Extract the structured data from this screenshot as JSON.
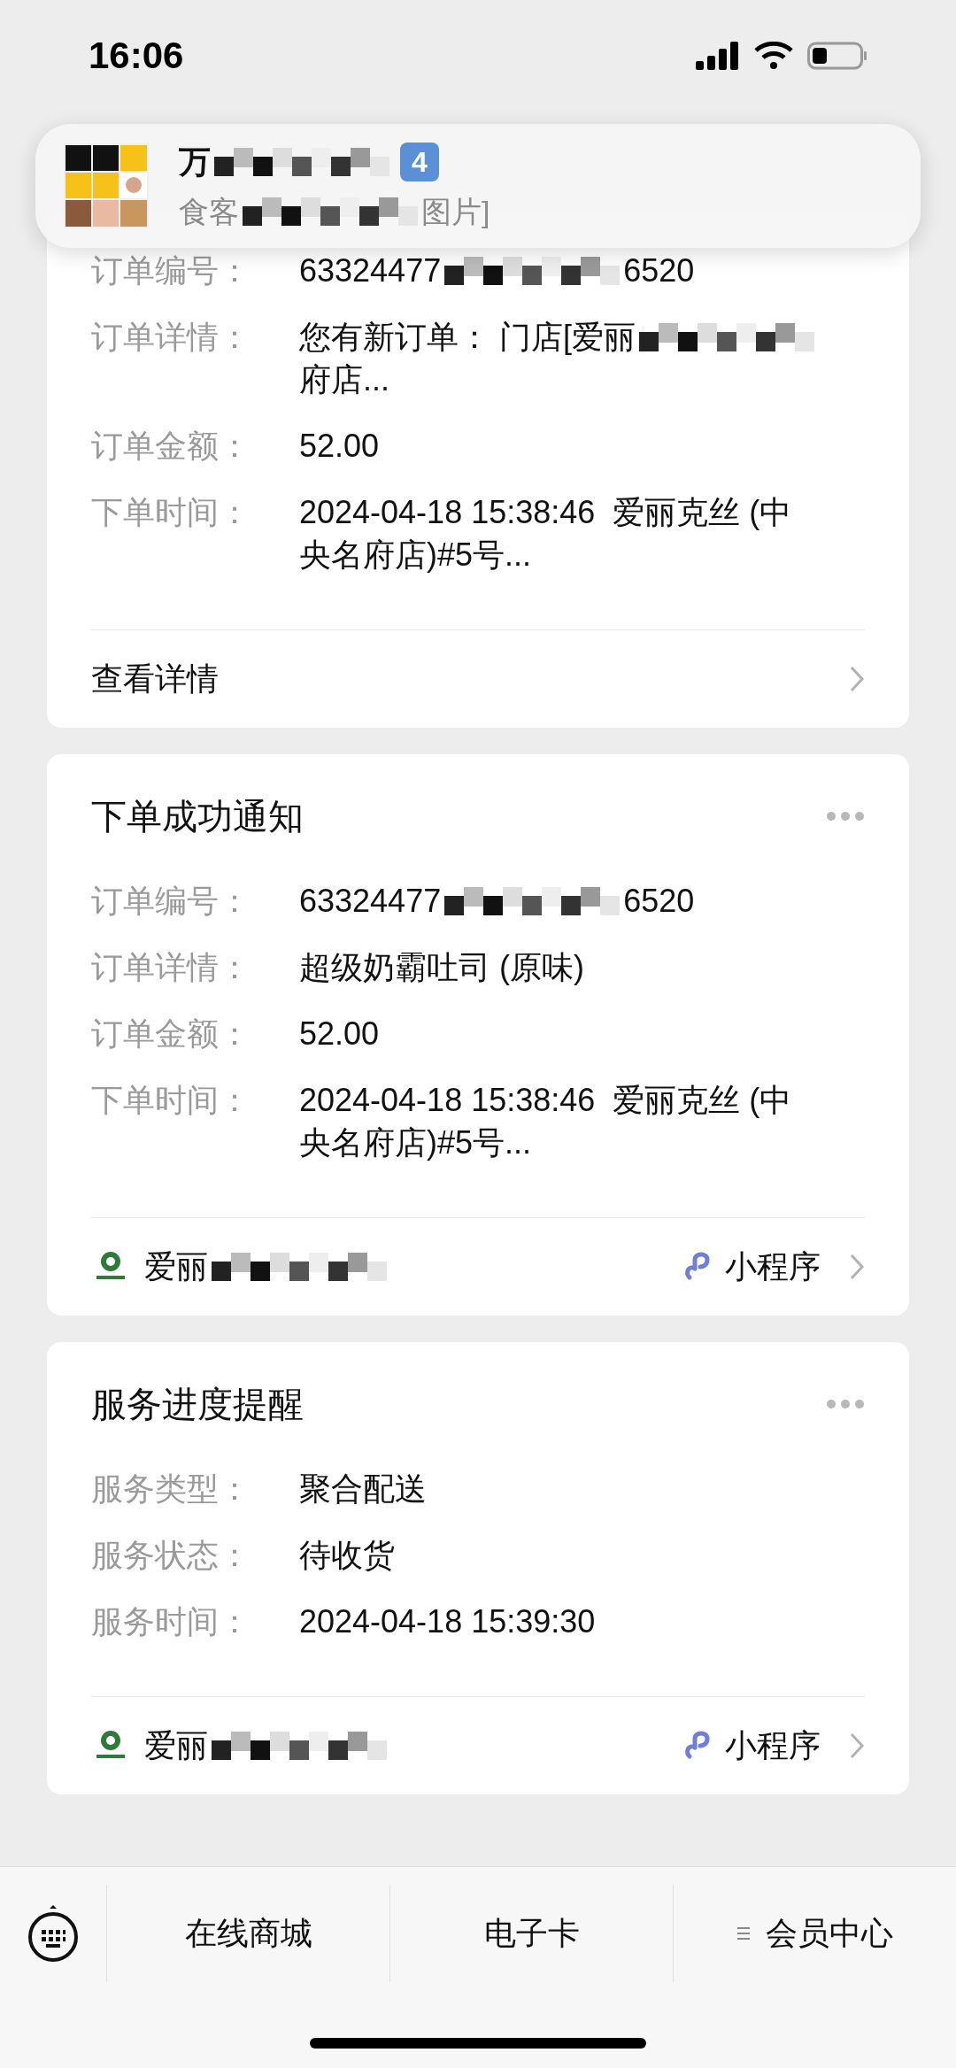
{
  "status_bar": {
    "time": "16:06"
  },
  "notification": {
    "title": "万",
    "badge": "4",
    "preview_start": "食客",
    "preview_end": "图片]"
  },
  "cards": [
    {
      "title_visible": false,
      "fields": [
        {
          "label": "订单编号：",
          "lines": [
            [
              {
                "kind": "text",
                "text": "63324477"
              },
              {
                "kind": "mosaic"
              },
              {
                "kind": "text",
                "text": "6520"
              }
            ]
          ]
        },
        {
          "label": "订单详情：",
          "lines": [
            [
              {
                "kind": "text",
                "text": "您有新订单： 门店[爱丽"
              },
              {
                "kind": "mosaic"
              }
            ],
            [
              {
                "kind": "text",
                "text": "府店..."
              }
            ]
          ]
        },
        {
          "label": "订单金额：",
          "lines": [
            [
              {
                "kind": "text",
                "text": "52.00"
              }
            ]
          ]
        },
        {
          "label": "下单时间：",
          "lines": [
            [
              {
                "kind": "text",
                "text": "2024-04-18 15:38:46  爱丽克丝 (中"
              }
            ],
            [
              {
                "kind": "text",
                "text": "央名府店)#5号..."
              }
            ]
          ]
        }
      ],
      "footer": {
        "kind": "link",
        "label": "查看详情"
      }
    },
    {
      "title": "下单成功通知",
      "title_visible": true,
      "fields": [
        {
          "label": "订单编号：",
          "lines": [
            [
              {
                "kind": "text",
                "text": "63324477"
              },
              {
                "kind": "mosaic"
              },
              {
                "kind": "text",
                "text": "6520"
              }
            ]
          ]
        },
        {
          "label": "订单详情：",
          "lines": [
            [
              {
                "kind": "text",
                "text": "超级奶霸吐司 (原味)"
              }
            ]
          ]
        },
        {
          "label": "订单金额：",
          "lines": [
            [
              {
                "kind": "text",
                "text": "52.00"
              }
            ]
          ]
        },
        {
          "label": "下单时间：",
          "lines": [
            [
              {
                "kind": "text",
                "text": "2024-04-18 15:38:46  爱丽克丝 (中"
              }
            ],
            [
              {
                "kind": "text",
                "text": "央名府店)#5号..."
              }
            ]
          ]
        }
      ],
      "footer": {
        "kind": "mini_program",
        "name": "爱丽",
        "tag": "小程序"
      }
    },
    {
      "title": "服务进度提醒",
      "title_visible": true,
      "fields": [
        {
          "label": "服务类型：",
          "lines": [
            [
              {
                "kind": "text",
                "text": "聚合配送"
              }
            ]
          ]
        },
        {
          "label": "服务状态：",
          "lines": [
            [
              {
                "kind": "text",
                "text": "待收货"
              }
            ]
          ]
        },
        {
          "label": "服务时间：",
          "lines": [
            [
              {
                "kind": "text",
                "text": "2024-04-18 15:39:30"
              }
            ]
          ]
        }
      ],
      "footer": {
        "kind": "mini_program",
        "name": "爱丽",
        "tag": "小程序"
      }
    }
  ],
  "bottom_menu": [
    {
      "label": "在线商城",
      "has_menu_icon": false
    },
    {
      "label": "电子卡",
      "has_menu_icon": false
    },
    {
      "label": "会员中心",
      "has_menu_icon": true
    }
  ]
}
